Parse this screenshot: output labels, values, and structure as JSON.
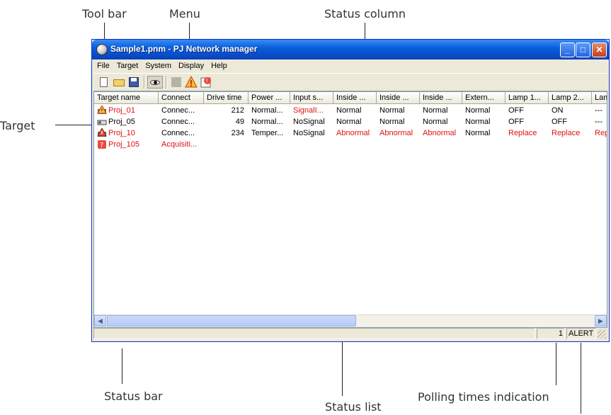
{
  "annotations": {
    "toolbar": "Tool bar",
    "menu": "Menu",
    "status_column": "Status column",
    "target": "Target",
    "status_bar": "Status bar",
    "status_list": "Status list",
    "polling": "Polling times indication"
  },
  "window": {
    "title": "Sample1.pnm - PJ Network manager",
    "icon": "app-globe-icon"
  },
  "menu": [
    "File",
    "Target",
    "System",
    "Display",
    "Help"
  ],
  "toolbar_icons": [
    "new-icon",
    "open-folder-icon",
    "save-icon",
    "eye-icon",
    "stop-icon",
    "alert-icon",
    "error-log-icon"
  ],
  "columns": [
    "Target name",
    "Connect",
    "Drive time",
    "Power ...",
    "Input s...",
    "Inside ...",
    "Inside ...",
    "Inside ...",
    "Extern...",
    "Lamp 1...",
    "Lamp 2...",
    "Lam"
  ],
  "rows": [
    {
      "icon": "projector-warning-icon",
      "name_red": true,
      "cells": [
        "Proj_01",
        "Connec...",
        "212",
        "Normal...",
        "SignalI...",
        "Normal",
        "Normal",
        "Normal",
        "Normal",
        "OFF",
        "ON",
        "---"
      ],
      "red": [
        0,
        4
      ]
    },
    {
      "icon": "projector-icon",
      "name_red": false,
      "cells": [
        "Proj_05",
        "Connec...",
        "49",
        "Normal...",
        "NoSignal",
        "Normal",
        "Normal",
        "Normal",
        "Normal",
        "OFF",
        "OFF",
        "---"
      ],
      "red": []
    },
    {
      "icon": "projector-error-icon",
      "name_red": true,
      "cells": [
        "Proj_10",
        "Connec...",
        "234",
        "Temper...",
        "NoSignal",
        "Abnormal",
        "Abnormal",
        "Abnormal",
        "Normal",
        "Replace",
        "Replace",
        "Rep"
      ],
      "red": [
        0,
        5,
        6,
        7,
        9,
        10,
        11
      ]
    },
    {
      "icon": "projector-unknown-icon",
      "name_red": true,
      "cells": [
        "Proj_105",
        "Acquisiti...",
        "",
        "",
        "",
        "",
        "",
        "",
        "",
        "",
        "",
        ""
      ],
      "red": [
        0,
        1
      ]
    }
  ],
  "statusbar": {
    "message": "",
    "polling_count": "1",
    "alert": "ALERT"
  },
  "colors": {
    "title_bar": "#0a5fdc",
    "alert_text": "#e01010",
    "window_bg": "#ece9d8"
  }
}
